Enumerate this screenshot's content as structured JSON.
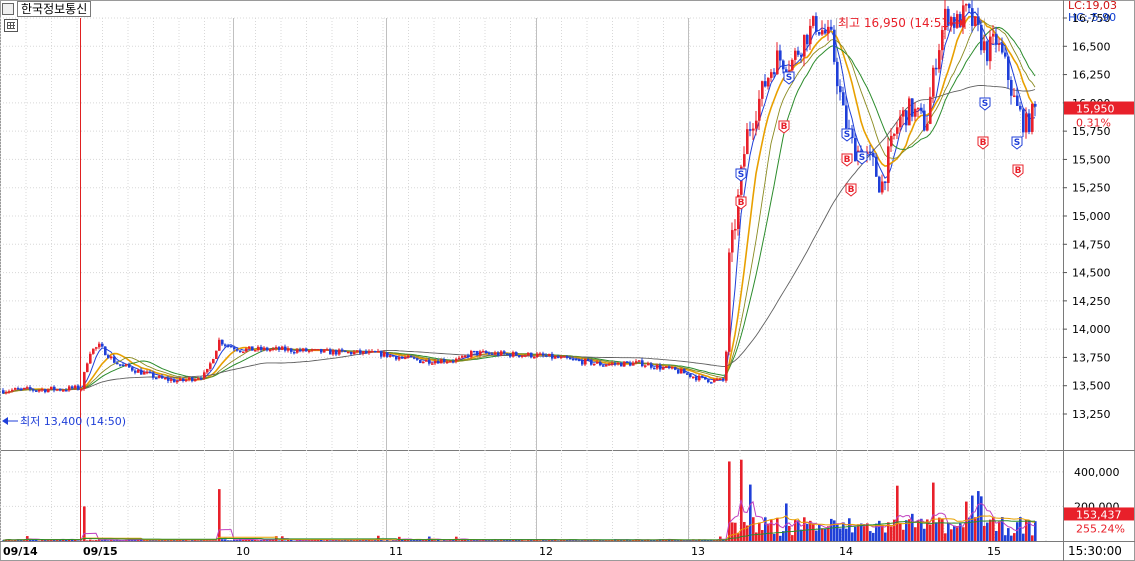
{
  "window": {
    "title": "한국정보통신"
  },
  "indicators": {
    "lc": "LC:19,03",
    "hc": "HC:-5,90"
  },
  "price_axis": {
    "ticks": [
      "16,750",
      "16,500",
      "16,250",
      "16,000",
      "15,750",
      "15,500",
      "15,250",
      "15,000",
      "14,750",
      "14,500",
      "14,250",
      "14,000",
      "13,750",
      "13,500",
      "13,250"
    ],
    "current_price": "15,950",
    "change_pct": "0.31%"
  },
  "volume_axis": {
    "ticks": [
      "400,000",
      "200,000"
    ],
    "current_volume": "153,437",
    "volume_pct": "255.24%"
  },
  "time_axis": {
    "labels": [
      "09/14",
      "09/15",
      "10",
      "11",
      "12",
      "13",
      "14",
      "15"
    ],
    "clock": "15:30:00"
  },
  "annotations": {
    "high": "최고 16,950 (14:51)",
    "low": "최저 13,400 (14:50)"
  },
  "signal_markers": {
    "buy": "B",
    "sell": "S"
  },
  "colors": {
    "up": "#e8202a",
    "down": "#1f3fd8",
    "ma_orange": "#e8a000",
    "ma_green": "#2c8c2c",
    "ma_gray": "#606060",
    "ma_olive": "#8a8a20",
    "background": "#ffffff",
    "grid": "#d8d8d8"
  },
  "chart_data": {
    "type": "candlestick",
    "title": "한국정보통신",
    "price_range": [
      13200,
      17050
    ],
    "volume_range": [
      0,
      480000
    ],
    "sessions": [
      "09/14",
      "09/15",
      "10",
      "11",
      "12",
      "13",
      "14",
      "15"
    ],
    "high": {
      "value": 16950,
      "time": "14:51"
    },
    "low": {
      "value": 13400,
      "time": "14:50"
    },
    "last_price": 15950,
    "last_volume": 153437,
    "price_profile": [
      {
        "session": "09/14",
        "open": 13450,
        "close": 13480
      },
      {
        "session": "09/15",
        "open": 13480,
        "close": 13700
      },
      {
        "session": "10",
        "open": 13700,
        "close": 13800
      },
      {
        "session": "11",
        "open": 13800,
        "close": 13720
      },
      {
        "session": "12",
        "open": 13720,
        "close": 13740
      },
      {
        "session": "13",
        "open": 13740,
        "close": 13520
      },
      {
        "session": "13",
        "open": 13520,
        "close": 16600
      },
      {
        "session": "14",
        "open": 16600,
        "close": 15300
      },
      {
        "session": "14",
        "open": 15300,
        "close": 16900
      },
      {
        "session": "15",
        "open": 16900,
        "close": 15950
      }
    ]
  }
}
